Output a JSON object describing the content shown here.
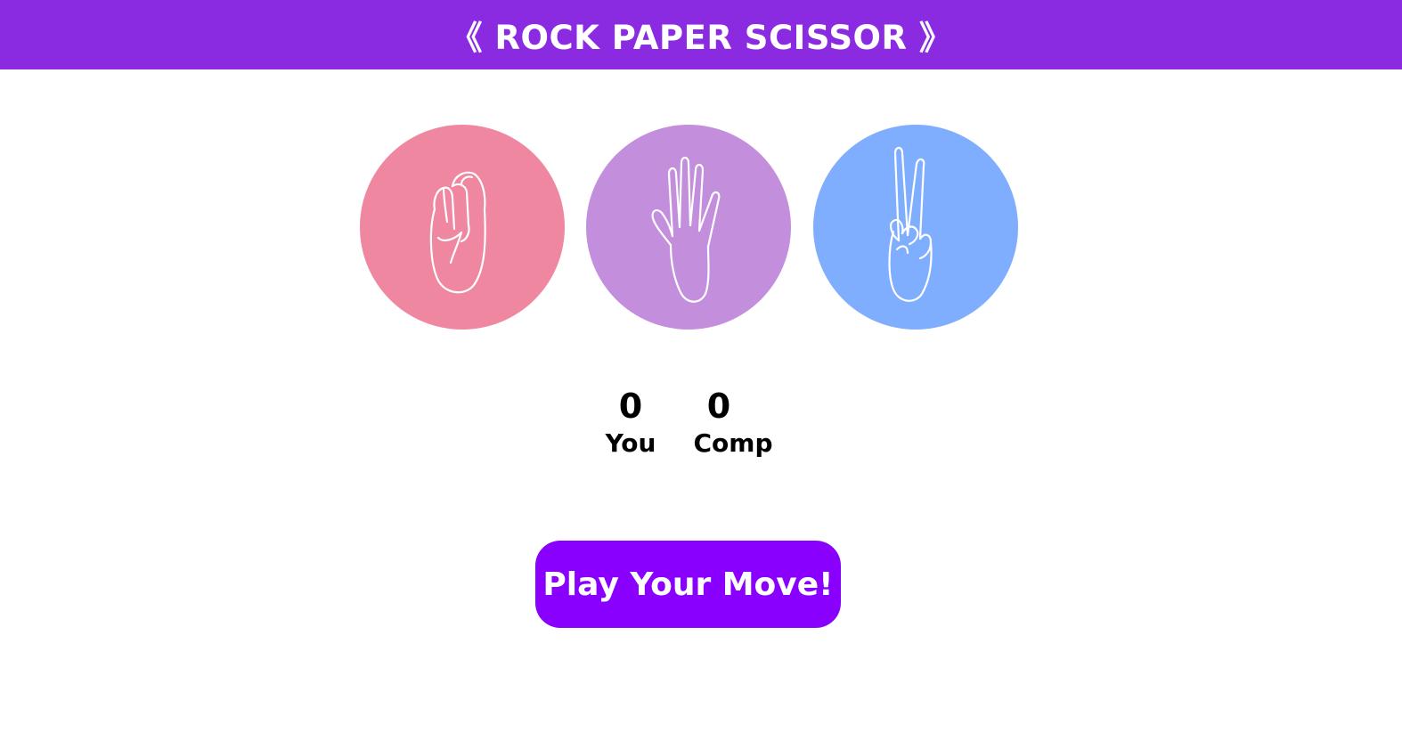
{
  "header": {
    "title": "《 ROCK PAPER SCISSOR 》",
    "background": "#8a2be2"
  },
  "choices": [
    {
      "name": "rock",
      "icon": "fist-icon",
      "color": "#f087a1"
    },
    {
      "name": "paper",
      "icon": "open-hand-icon",
      "color": "#c38fdd"
    },
    {
      "name": "scissor",
      "icon": "peace-hand-icon",
      "color": "#80aeff"
    }
  ],
  "score": {
    "user": {
      "value": "0",
      "label": "You"
    },
    "computer": {
      "value": "0",
      "label": "Comp"
    }
  },
  "play_button": {
    "label": "Play Your Move!",
    "color": "#8a00ff"
  }
}
